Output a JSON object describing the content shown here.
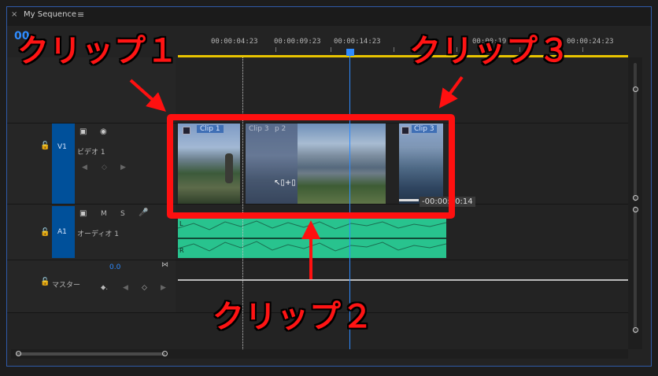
{
  "tab": {
    "close": "×",
    "title": "My Sequence",
    "menu": "≡"
  },
  "timecode": "00",
  "ruler": {
    "labels": [
      "00:00:04:23",
      "00:00:09:23",
      "00:00:14:23",
      "00:00:19:23",
      "00:00:24:23"
    ]
  },
  "tracks": {
    "v1": {
      "id": "V1",
      "name": "ビデオ 1"
    },
    "a1": {
      "id": "A1",
      "name": "オーディオ 1",
      "m": "M",
      "s": "S"
    },
    "master": {
      "name": "マスター",
      "value": "0.0"
    }
  },
  "clips": {
    "clip1": "Clip 1",
    "clip2_ghost": "Clip 3  p 2",
    "clip3": "Clip 3",
    "tooltip": "-00:00:00:14"
  },
  "audio_channels": {
    "left": "L",
    "right": "R"
  },
  "callouts": {
    "c1": "クリップ１",
    "c2": "クリップ２",
    "c3": "クリップ３"
  },
  "colors": {
    "accent": "#2e8bff",
    "highlight": "#ff1010",
    "audio": "#2fd39a",
    "track_header": "#00509a"
  }
}
